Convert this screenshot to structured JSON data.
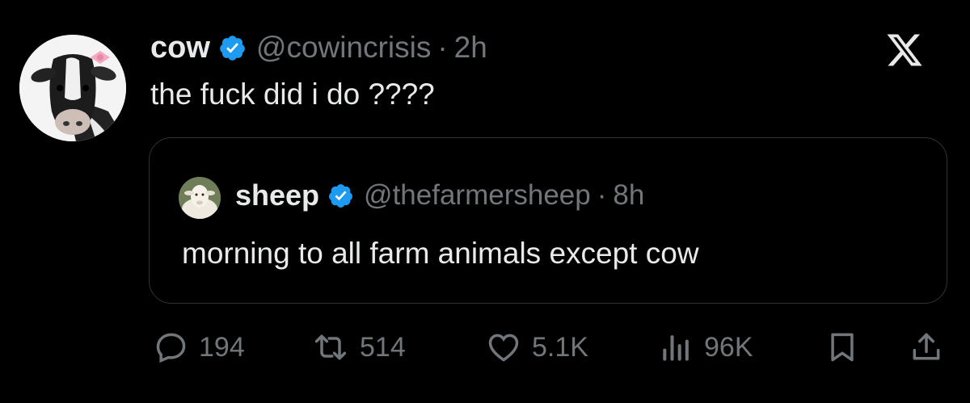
{
  "tweet": {
    "author_name": "cow",
    "author_handle": "@cowincrisis",
    "separator": "·",
    "time_ago": "2h",
    "text": "the fuck did i do ????"
  },
  "quoted_tweet": {
    "author_name": "sheep",
    "author_handle": "@thefarmersheep",
    "separator": "·",
    "time_ago": "8h",
    "text": "morning to all farm animals except cow"
  },
  "actions": {
    "replies": "194",
    "reposts": "514",
    "likes": "5.1K",
    "views": "96K"
  },
  "colors": {
    "background": "#000000",
    "text_primary": "#e7e9ea",
    "text_secondary": "#71767b",
    "verified_blue": "#1d9bf0",
    "border": "#2f3336"
  },
  "icons": [
    "verified-badge-icon",
    "x-logo-icon",
    "reply-icon",
    "repost-icon",
    "like-icon",
    "views-icon",
    "bookmark-icon",
    "share-icon"
  ]
}
